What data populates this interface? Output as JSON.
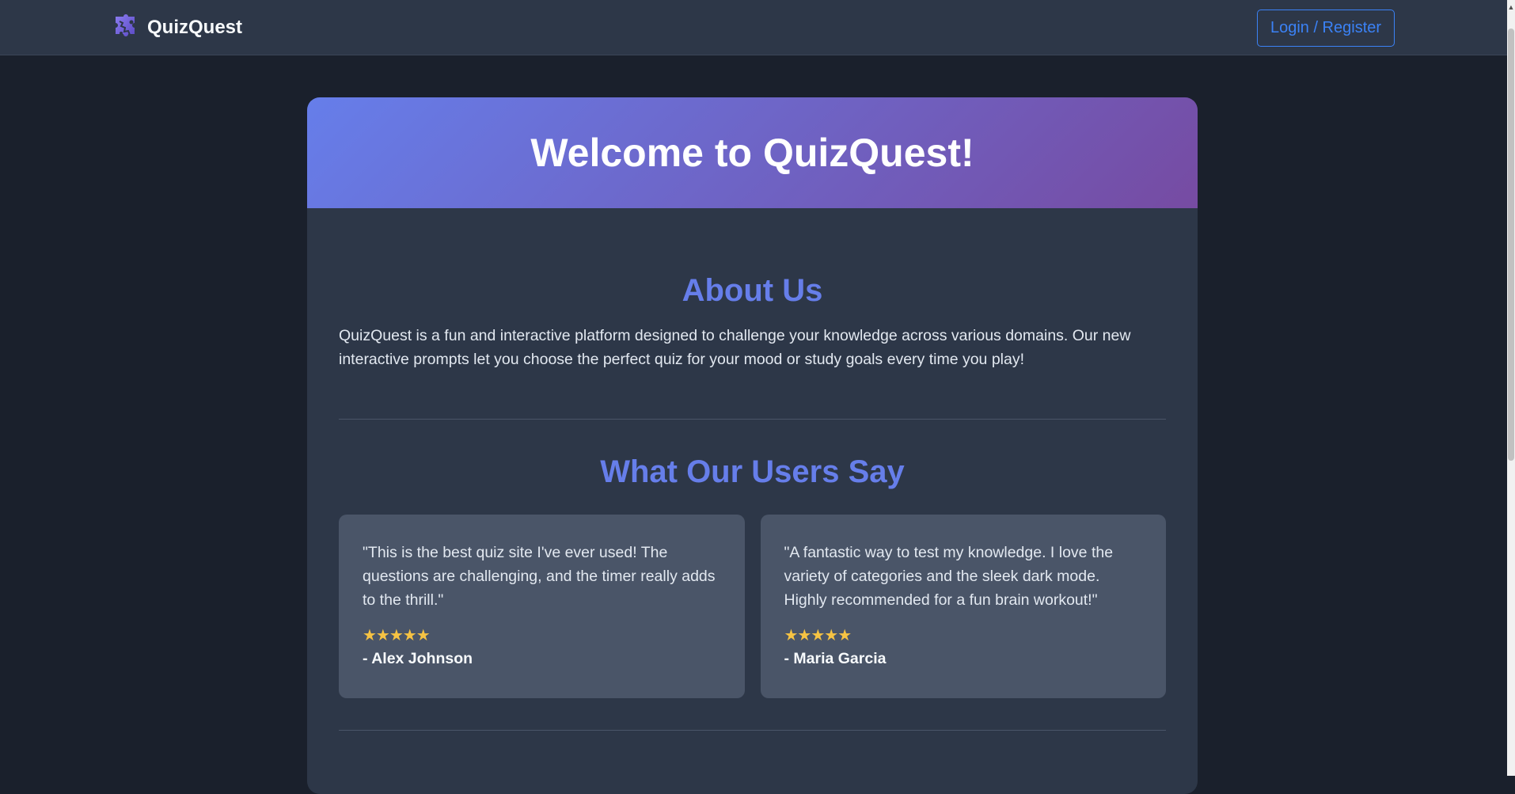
{
  "header": {
    "brand_name": "QuizQuest",
    "brand_icon": "puzzle-logo-icon",
    "login_label": "Login / Register",
    "accent_color": "#3b82f6"
  },
  "hero": {
    "title": "Welcome to QuizQuest!",
    "gradient": [
      "#667eea",
      "#764ba2"
    ]
  },
  "about": {
    "title": "About Us",
    "text": "QuizQuest is a fun and interactive platform designed to challenge your knowledge across various domains. Our new interactive prompts let you choose the perfect quiz for your mood or study goals every time you play!"
  },
  "testimonials": {
    "title": "What Our Users Say",
    "items": [
      {
        "quote": "\"This is the best quiz site I've ever used! The questions are challenging, and the timer really adds to the thrill.\"",
        "stars": "★★★★★",
        "rating": 5,
        "author": "- Alex Johnson"
      },
      {
        "quote": "\"A fantastic way to test my knowledge. I love the variety of categories and the sleek dark mode. Highly recommended for a fun brain workout!\"",
        "stars": "★★★★★",
        "rating": 5,
        "author": "- Maria Garcia"
      }
    ]
  },
  "colors": {
    "page_bg": "#1a202c",
    "card_bg": "#2d3748",
    "heading": "#667eea",
    "star": "#f6c343"
  }
}
